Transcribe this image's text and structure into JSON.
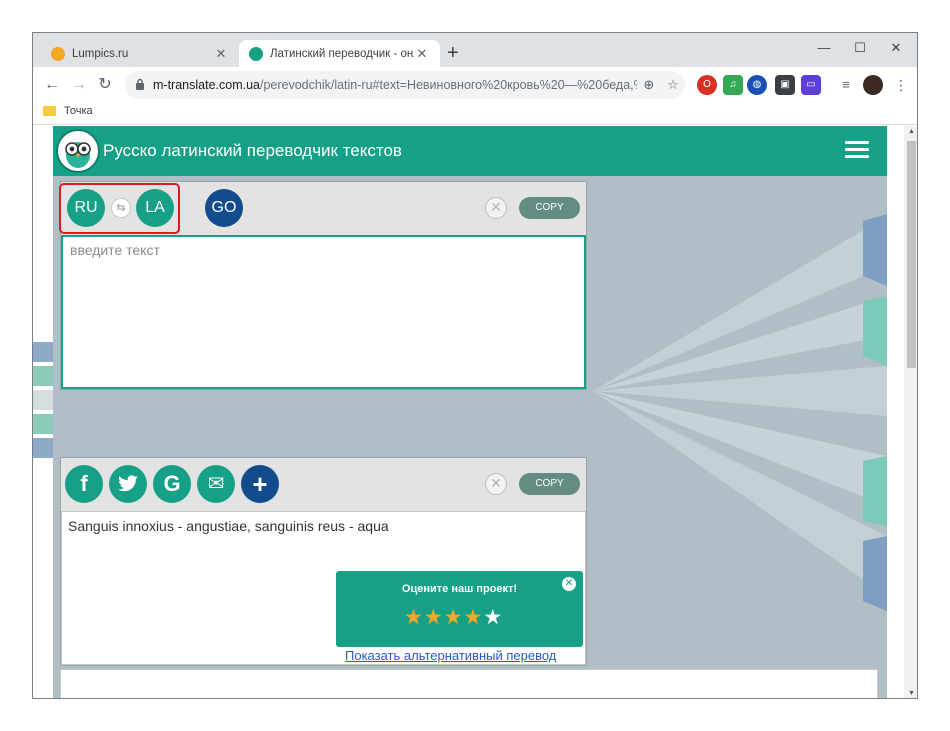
{
  "browser": {
    "tabs": [
      {
        "title": "Lumpics.ru",
        "active": false,
        "favicon_color": "#f5a623"
      },
      {
        "title": "Латинский переводчик - онлай",
        "active": true,
        "favicon_color": "#16a085"
      }
    ],
    "new_tab_symbol": "+",
    "close_symbol": "✕",
    "window_controls": {
      "minimize": "—",
      "maximize": "☐",
      "close": "✕"
    },
    "nav": {
      "back": "←",
      "forward": "→",
      "reload": "↻"
    },
    "url": {
      "host": "m-translate.com.ua",
      "path": "/perevodchik/latin-ru#text=Невиновного%20кровь%20—%20беда,%..."
    },
    "extensions": [
      {
        "icon": "opera-icon",
        "badge": "7",
        "color": "#d93025"
      },
      {
        "icon": "music-icon",
        "color": "#34a853"
      },
      {
        "icon": "globe-icon",
        "color": "#1a4fb4"
      },
      {
        "icon": "cube-icon",
        "badge": "1",
        "color": "#3c4043"
      },
      {
        "icon": "screen-icon",
        "color": "#5b3fd6"
      }
    ],
    "bookmarks": [
      {
        "label": "Точка",
        "icon": "folder-icon"
      }
    ]
  },
  "site": {
    "title": "Русско латинский переводчик текстов",
    "brand_color": "#16a085"
  },
  "source_panel": {
    "lang_from": "RU",
    "lang_to": "LA",
    "swap_symbol": "⇆",
    "go_label": "GO",
    "clear_symbol": "✕",
    "copy_label": "COPY",
    "input_placeholder": "введите текст",
    "input_value": ""
  },
  "result_panel": {
    "share_buttons": [
      {
        "icon": "facebook-icon",
        "glyph": "f"
      },
      {
        "icon": "twitter-icon",
        "glyph": "t"
      },
      {
        "icon": "google-icon",
        "glyph": "G"
      },
      {
        "icon": "mail-icon",
        "glyph": "✉"
      },
      {
        "icon": "plus-icon",
        "glyph": "+"
      }
    ],
    "clear_symbol": "✕",
    "copy_label": "COPY",
    "output_text": "Sanguis innoxius - angustiae, sanguinis reus - aqua",
    "rating": {
      "title": "Оцените наш проект!",
      "close_symbol": "✕",
      "stars_filled": 4,
      "stars_total": 5,
      "star_glyph": "★"
    },
    "alt_link": "Показать альтернативный перевод"
  }
}
